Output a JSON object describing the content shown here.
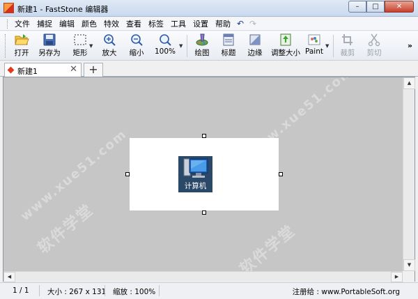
{
  "window": {
    "title": "新建1 - FastStone 编辑器",
    "controls": {
      "minimize": "–",
      "maximize": "□",
      "close": "✕"
    }
  },
  "menu": {
    "items": [
      "文件",
      "捕捉",
      "编辑",
      "颜色",
      "特效",
      "查看",
      "标签",
      "工具",
      "设置",
      "帮助"
    ],
    "undo_icon": "undo-icon",
    "redo_icon": "redo-icon"
  },
  "toolbar": {
    "buttons": [
      {
        "label": "打开",
        "icon": "open-folder-icon"
      },
      {
        "label": "另存为",
        "icon": "save-disk-icon"
      },
      {
        "label": "矩形",
        "icon": "rectangle-select-icon"
      },
      {
        "label": "放大",
        "icon": "zoom-in-icon"
      },
      {
        "label": "缩小",
        "icon": "zoom-out-icon"
      },
      {
        "label": "100%",
        "icon": "zoom-actual-icon"
      },
      {
        "label": "绘图",
        "icon": "draw-icon"
      },
      {
        "label": "标题",
        "icon": "caption-icon"
      },
      {
        "label": "边缘",
        "icon": "edge-icon"
      },
      {
        "label": "调整大小",
        "icon": "resize-icon"
      },
      {
        "label": "Paint",
        "icon": "paint-icon"
      },
      {
        "label": "裁剪",
        "icon": "crop-icon",
        "disabled": true
      },
      {
        "label": "剪切",
        "icon": "scissors-icon",
        "disabled": true
      }
    ],
    "more": "»"
  },
  "tabs": {
    "items": [
      {
        "label": "新建1",
        "close": "✕"
      }
    ],
    "new_tab": "+"
  },
  "canvas": {
    "image": {
      "icon_label": "计算机"
    },
    "watermark_text": "软件学堂",
    "watermark_url": "www.xue51.com"
  },
  "status": {
    "page": "1 / 1",
    "size": "大小 : 267 x 131",
    "zoom": "缩放 : 100%",
    "register": "注册给 : www.PortableSoft.org"
  },
  "colors": {
    "canvas_bg": "#c6c6c6",
    "title_gradient_top": "#dfe9f5",
    "close_button": "#c6402b",
    "tab_marker": "#e03a1f"
  }
}
